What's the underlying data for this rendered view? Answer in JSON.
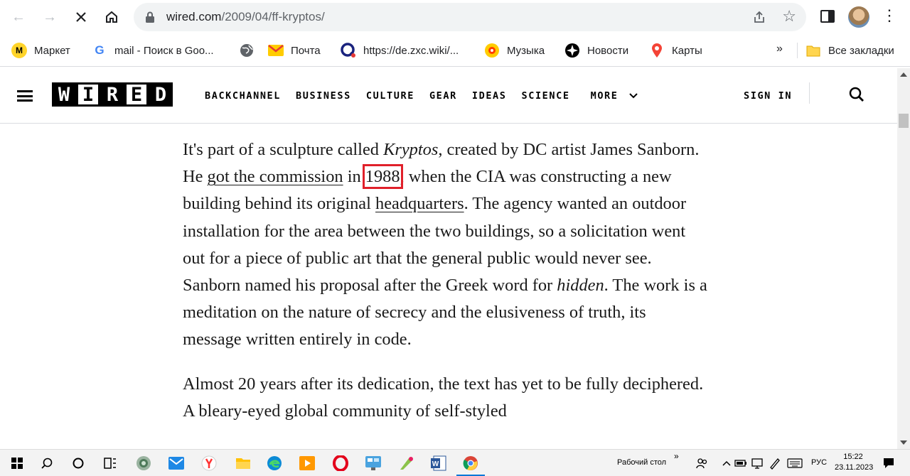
{
  "browser": {
    "url_host": "wired.com",
    "url_path": "/2009/04/ff-kryptos/",
    "bookmarks": [
      {
        "label": "Маркет",
        "icon": "yandex-market-icon"
      },
      {
        "label": "mail - Поиск в Goo...",
        "icon": "google-icon"
      },
      {
        "label": "",
        "icon": "globe-icon"
      },
      {
        "label": "Почта",
        "icon": "mail-icon"
      },
      {
        "label": "https://de.zxc.wiki/...",
        "icon": "zxc-wiki-icon"
      },
      {
        "label": "Музыка",
        "icon": "music-icon"
      },
      {
        "label": "Новости",
        "icon": "news-icon"
      },
      {
        "label": "Карты",
        "icon": "maps-pin-icon"
      }
    ],
    "bookmarks_overflow": "»",
    "all_bookmarks": "Все закладки"
  },
  "site": {
    "logo_letters": [
      "W",
      "I",
      "R",
      "E",
      "D"
    ],
    "nav": [
      "BACKCHANNEL",
      "BUSINESS",
      "CULTURE",
      "GEAR",
      "IDEAS",
      "SCIENCE"
    ],
    "more": "MORE",
    "sign_in": "SIGN IN"
  },
  "article": {
    "p1": {
      "t1": "It's part of a sculpture called ",
      "em1": "Kryptos",
      "t2": ", created by DC artist James Sanborn. He ",
      "link1": "got the commission",
      "t3": " in ",
      "year": "1988",
      "t4": ", when the CIA was constructing a new building behind its original ",
      "link2": "headquarters",
      "t5": ". The agency wanted an outdoor installation for the area between the two buildings, so a solicitation went out for a piece of public art that the general public would never see. Sanborn named his proposal after the Greek word for ",
      "em2": "hidden",
      "t6": ". The work is a meditation on the nature of secrecy and the elusiveness of truth, its message written entirely in code."
    },
    "p2": "Almost 20 years after its dedication, the text has yet to be fully deciphered. A bleary-eyed global community of self-styled"
  },
  "taskbar": {
    "desktop_label": "Рабочий стол",
    "chevron": "»",
    "lang": "РУС",
    "time": "15:22",
    "date": "23.11.2023"
  }
}
